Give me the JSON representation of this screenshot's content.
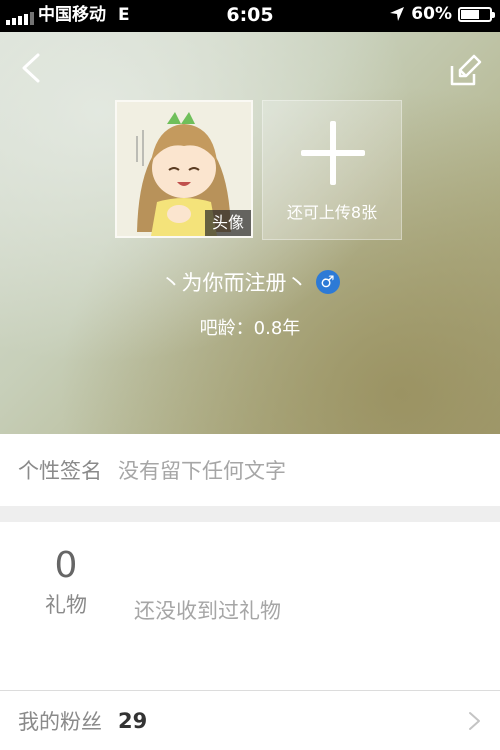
{
  "status_bar": {
    "carrier": "中国移动",
    "network": "E",
    "time": "6:05",
    "battery": "60%",
    "battery_level": 0.6,
    "icons": [
      "signal-bars-icon",
      "location-arrow-icon",
      "battery-icon"
    ]
  },
  "header": {
    "back_icon": "chevron-left-icon",
    "edit_icon": "edit-icon",
    "avatar_tag": "头像",
    "upload_label": "还可上传8张",
    "username": "丶为你而注册丶",
    "gender_symbol": "♂",
    "tieba_age": "吧龄：0.8年"
  },
  "signature": {
    "label": "个性签名",
    "value": "没有留下任何文字"
  },
  "gifts": {
    "count": "0",
    "label": "礼物",
    "empty_text": "还没收到过礼物"
  },
  "fans": {
    "label": "我的粉丝",
    "count": "29"
  },
  "colors": {
    "gender_badge": "#2d7ad6",
    "section_gap": "#eeeeee",
    "label_gray": "#8a8a8a"
  }
}
